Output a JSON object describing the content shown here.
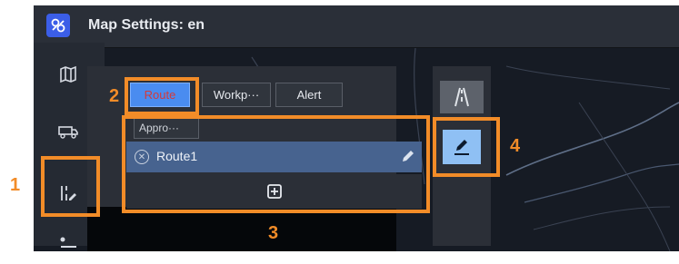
{
  "window": {
    "title": "Map Settings: en"
  },
  "sidebar": {
    "items": [
      {
        "icon": "map-icon"
      },
      {
        "icon": "truck-icon"
      },
      {
        "icon": "edit-settings-icon"
      },
      {
        "icon": "layer-icon"
      }
    ]
  },
  "tabs": [
    {
      "label": "Route",
      "active": true
    },
    {
      "label": "Workp···",
      "active": false
    },
    {
      "label": "Alert",
      "active": false
    }
  ],
  "subtab": {
    "label": "Appro···"
  },
  "routes": [
    {
      "label": "Route1"
    }
  ],
  "callouts": [
    "1",
    "2",
    "3",
    "4"
  ],
  "colors": {
    "accent": "#4a8cf0",
    "highlight": "#f28c28",
    "active_tab_text": "#d43a3a"
  }
}
